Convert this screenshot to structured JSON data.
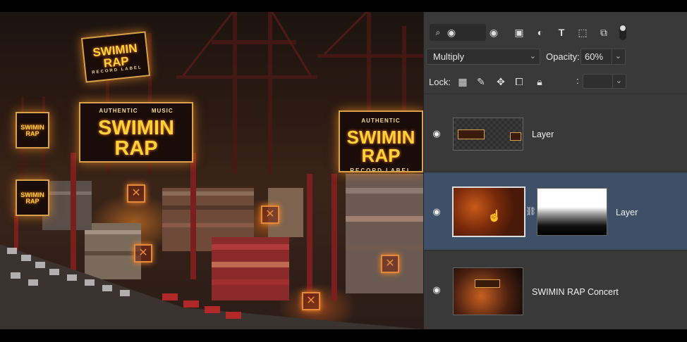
{
  "panel": {
    "blend_mode": "Multiply",
    "opacity_label": "Opacity:",
    "opacity_value": "60%",
    "lock_label": "Lock:",
    "fill_colon": ":"
  },
  "canvas_signs": {
    "authentic": "AUTHENTIC",
    "music": "MUSIC",
    "main": "SWIMIN RAP",
    "record": "RECORD LABEL"
  },
  "layers": [
    {
      "name": "Layer",
      "selected": false
    },
    {
      "name": "Layer",
      "selected": true
    },
    {
      "name": "SWIMIN RAP Concert",
      "selected": false
    }
  ],
  "icons": {
    "search": "search-icon",
    "eye_filter": "eye-icon",
    "image_filter": "image-icon",
    "adjust_filter": "adjustment-icon",
    "type_filter": "type-icon",
    "shape_filter": "shape-icon",
    "smart_filter": "smart-object-icon",
    "toggle": "filter-toggle-icon",
    "lock_pixels": "lock-transparent-pixels-icon",
    "lock_image": "brush-icon",
    "lock_position": "move-icon",
    "lock_artboard": "artboard-icon",
    "lock_all": "lock-icon"
  },
  "colors": {
    "panel_bg": "#393939",
    "selected_layer": "#3e5068",
    "sign_yellow": "#ffd23a"
  }
}
